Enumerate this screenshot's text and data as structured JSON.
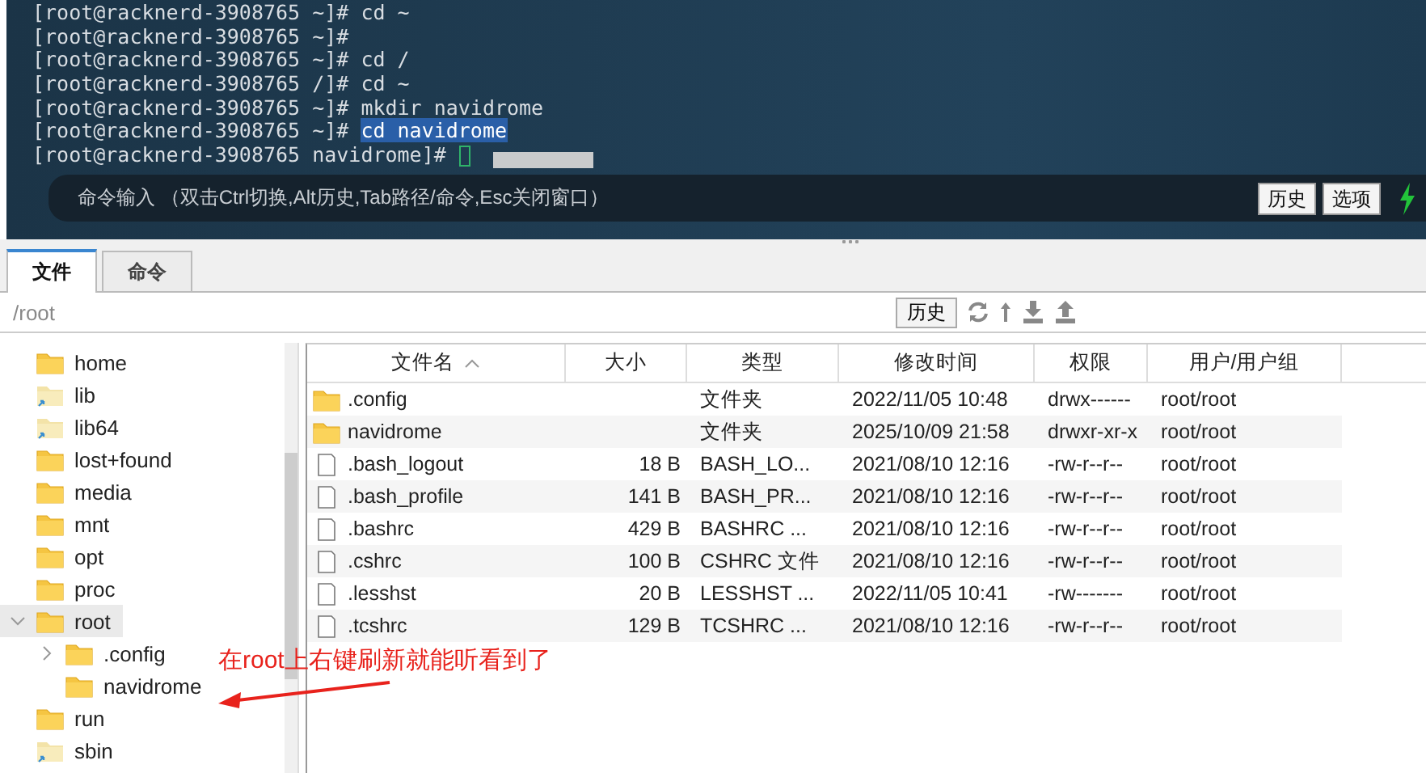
{
  "terminal": {
    "lines": [
      {
        "prompt": "[root@racknerd-3908765 ~]#",
        "command": "cd ~",
        "highlighted": false
      },
      {
        "prompt": "[root@racknerd-3908765 ~]#"
      },
      {
        "prompt": "[root@racknerd-3908765 ~]#",
        "command": "cd /",
        "highlighted": false
      },
      {
        "prompt": "[root@racknerd-3908765 /]#",
        "command": "cd ~",
        "highlighted": false
      },
      {
        "prompt": "[root@racknerd-3908765 ~]#",
        "command": "mkdir navidrome",
        "highlighted": false
      },
      {
        "prompt": "[root@racknerd-3908765 ~]#",
        "command": "cd navidrome",
        "highlighted": true
      },
      {
        "prompt": "[root@racknerd-3908765 navidrome]#"
      }
    ],
    "command_input": {
      "placeholder": "命令输入 （双击Ctrl切换,Alt历史,Tab路径/命令,Esc关闭窗口）"
    },
    "buttons": [
      "历史",
      "选项"
    ]
  },
  "tabs": [
    {
      "label": "文件",
      "selected": true
    },
    {
      "label": "命令",
      "selected": false
    }
  ],
  "path_bar": {
    "path": "/root",
    "history_button": "历史"
  },
  "tree": [
    {
      "name": "home",
      "kind": "folder",
      "selected": false
    },
    {
      "name": "lib",
      "kind": "symlink",
      "selected": false
    },
    {
      "name": "lib64",
      "kind": "symlink",
      "selected": false
    },
    {
      "name": "lost+found",
      "kind": "folder",
      "selected": false
    },
    {
      "name": "media",
      "kind": "folder",
      "selected": false
    },
    {
      "name": "mnt",
      "kind": "folder",
      "selected": false
    },
    {
      "name": "opt",
      "kind": "folder",
      "selected": false
    },
    {
      "name": "proc",
      "kind": "folder",
      "selected": false
    },
    {
      "name": "root",
      "kind": "folder",
      "selected": true,
      "expanded": true,
      "children": [
        {
          "name": ".config",
          "kind": "folder",
          "selected": false,
          "expanded": false
        },
        {
          "name": "navidrome",
          "kind": "folder",
          "selected": false
        }
      ]
    },
    {
      "name": "run",
      "kind": "folder",
      "selected": false
    },
    {
      "name": "sbin",
      "kind": "symlink",
      "selected": false
    }
  ],
  "table": {
    "columns": [
      "文件名",
      "大小",
      "类型",
      "修改时间",
      "权限",
      "用户/用户组"
    ],
    "rows": [
      {
        "kind": "folder",
        "cells": [
          ".config",
          "",
          "文件夹",
          "2022/11/05 10:48",
          "drwx------",
          "root/root"
        ]
      },
      {
        "kind": "folder",
        "cells": [
          "navidrome",
          "",
          "文件夹",
          "2025/10/09 21:58",
          "drwxr-xr-x",
          "root/root"
        ]
      },
      {
        "kind": "file",
        "cells": [
          ".bash_logout",
          "18 B",
          "BASH_LO...",
          "2021/08/10 12:16",
          "-rw-r--r--",
          "root/root"
        ]
      },
      {
        "kind": "file",
        "cells": [
          ".bash_profile",
          "141 B",
          "BASH_PR...",
          "2021/08/10 12:16",
          "-rw-r--r--",
          "root/root"
        ]
      },
      {
        "kind": "file",
        "cells": [
          ".bashrc",
          "429 B",
          "BASHRC ...",
          "2021/08/10 12:16",
          "-rw-r--r--",
          "root/root"
        ]
      },
      {
        "kind": "file",
        "cells": [
          ".cshrc",
          "100 B",
          "CSHRC 文件",
          "2021/08/10 12:16",
          "-rw-r--r--",
          "root/root"
        ]
      },
      {
        "kind": "file",
        "cells": [
          ".lesshst",
          "20 B",
          "LESSHST ...",
          "2022/11/05 10:41",
          "-rw-------",
          "root/root"
        ]
      },
      {
        "kind": "file",
        "cells": [
          ".tcshrc",
          "129 B",
          "TCSHRC ...",
          "2021/08/10 12:16",
          "-rw-r--r--",
          "root/root"
        ]
      }
    ]
  },
  "annotation": {
    "text": "在root上右键刷新就能听看到了"
  }
}
